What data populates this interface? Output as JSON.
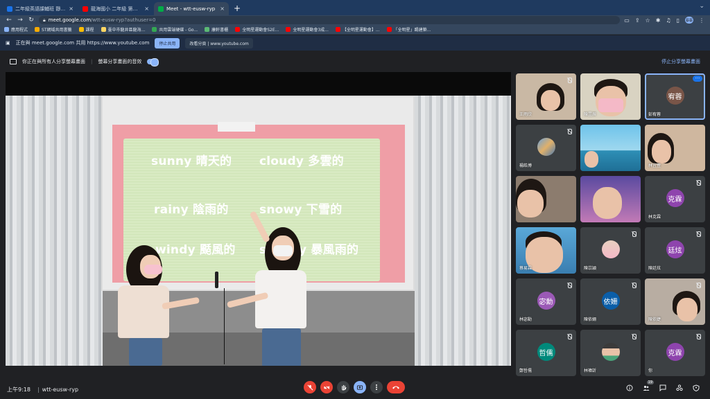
{
  "browser": {
    "tabs": [
      {
        "title": "二年級英語課輔班 靜宜大學英語",
        "color": "#1a73e8",
        "active": false
      },
      {
        "title": "龍海國小 二年級 第二組 - Y",
        "color": "#ff0000",
        "active": false
      },
      {
        "title": "Meet - wtt-eusw-ryp",
        "color": "#00ac47",
        "active": true
      }
    ],
    "tab_close": "×",
    "new_tab": "+",
    "url_host": "meet.google.com",
    "url_path": "/wtt-eusw-ryp?authuser=0",
    "profile_label": "蔡蔡"
  },
  "bookmarks": [
    {
      "label": "應用程式",
      "color": "#8ab4f8"
    },
    {
      "label": "ST網域共用書籤",
      "color": "#f9ab00"
    },
    {
      "label": "課程",
      "color": "#fbbc04"
    },
    {
      "label": "臺中市龍井區龍海...",
      "color": "#fdd663"
    },
    {
      "label": "共用雲端硬碟 - Go...",
      "color": "#34a853"
    },
    {
      "label": "康軒書櫃",
      "color": "#5bb974"
    },
    {
      "label": "全明星運動會S2E...",
      "color": "#ff0000"
    },
    {
      "label": "全明星運動會3成...",
      "color": "#ff0000"
    },
    {
      "label": "【全明星運動會】...",
      "color": "#ff0000"
    },
    {
      "label": "「全明星」踢建築...",
      "color": "#ff0000"
    }
  ],
  "share_banner": {
    "text": "正在與 meet.google.com 共用 https://www.youtube.com",
    "stop_label": "停止共用",
    "switch_label": "改看分頁 | www.youtube.com"
  },
  "presenting": {
    "text": "你正在與所有人分享螢幕畫面",
    "audio_label": "螢幕分享畫面的音效",
    "stop_label": "停止分享螢幕畫面"
  },
  "slide": {
    "words": [
      "sunny 晴天的",
      "cloudy 多雲的",
      "rainy 陰雨的",
      "snowy 下雪的",
      "windy 颳風的",
      "stormy 暴風雨的"
    ]
  },
  "participants": [
    {
      "name": "王雨欣",
      "type": "video"
    },
    {
      "name": "陳昱辰",
      "type": "video"
    },
    {
      "name": "彭宥蓉",
      "type": "avatar",
      "initials": "宥蓉",
      "color": "#795548",
      "speaking": true
    },
    {
      "name": "楊皓博",
      "type": "photo",
      "muted": true
    },
    {
      "name": "",
      "type": "video"
    },
    {
      "name": "林宜萱",
      "type": "video"
    },
    {
      "name": "",
      "type": "video"
    },
    {
      "name": "",
      "type": "video"
    },
    {
      "name": "林克霖",
      "type": "avatar",
      "initials": "克霖",
      "color": "#8e44ad",
      "muted": true
    },
    {
      "name": "蔡易霖",
      "type": "video"
    },
    {
      "name": "陳苡穎",
      "type": "photo",
      "muted": true
    },
    {
      "name": "陳廷炫",
      "type": "avatar",
      "initials": "廷炫",
      "color": "#8e44ad",
      "muted": true
    },
    {
      "name": "林宓勳",
      "type": "avatar",
      "initials": "宓勳",
      "color": "#9b59b6",
      "muted": true
    },
    {
      "name": "陳依姍",
      "type": "avatar",
      "initials": "依姍",
      "color": "#0b5ea8",
      "muted": true
    },
    {
      "name": "陳依婕",
      "type": "video",
      "muted": true
    },
    {
      "name": "鄭哲儒",
      "type": "avatar",
      "initials": "哲儒",
      "color": "#00897b",
      "muted": true
    },
    {
      "name": "林禕訢",
      "type": "photo",
      "muted": true
    },
    {
      "name": "你",
      "type": "avatar",
      "initials": "克霖",
      "color": "#8e44ad",
      "muted": true
    }
  ],
  "bottom": {
    "time": "上午9:18",
    "separator": "|",
    "meeting_code": "wtt-eusw-ryp",
    "people_count": "19"
  },
  "colors": {
    "meet_bg": "#202124",
    "accent": "#8ab4f8",
    "danger": "#ea4335"
  },
  "icons": {
    "mic": "mic-off-icon",
    "camera": "camera-off-icon",
    "hand": "raise-hand-icon",
    "present": "present-icon",
    "more": "more-options-icon",
    "end": "end-call-icon"
  }
}
